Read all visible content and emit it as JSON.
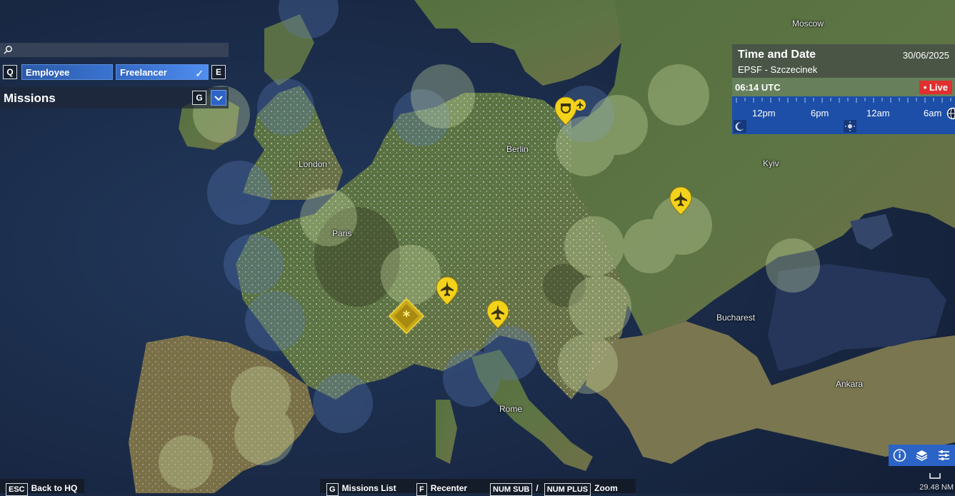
{
  "map": {
    "cities": [
      {
        "id": "moscow",
        "label": "Moscow"
      },
      {
        "id": "berlin",
        "label": "Berlin"
      },
      {
        "id": "london",
        "label": "London"
      },
      {
        "id": "paris",
        "label": "Paris"
      },
      {
        "id": "kyiv",
        "label": "Kyiv"
      },
      {
        "id": "bucharest",
        "label": "Bucharest"
      },
      {
        "id": "rome",
        "label": "Rome"
      },
      {
        "id": "ankara",
        "label": "Ankara"
      }
    ],
    "marker_icons": [
      "airplane-marker-icon",
      "pilot-marker-icon",
      "hq-diamond-icon"
    ]
  },
  "search": {
    "placeholder": "",
    "value": ""
  },
  "filters": {
    "left_key": "Q",
    "right_key": "E",
    "employee_label": "Employee",
    "freelancer_label": "Freelancer"
  },
  "missions": {
    "title": "Missions",
    "key": "G"
  },
  "time_panel": {
    "title": "Time and Date",
    "date": "30/06/2025",
    "location": "EPSF - Szczecinek",
    "utc_time": "06:14 UTC",
    "live_label": "• Live",
    "timeline_labels": [
      "12pm",
      "6pm",
      "12am",
      "6am"
    ]
  },
  "scale": {
    "label": "29.48 NM"
  },
  "hints": {
    "back": {
      "key": "ESC",
      "label": "Back to HQ"
    },
    "missions_list": {
      "key": "G",
      "label": "Missions List"
    },
    "recenter": {
      "key": "F",
      "label": "Recenter"
    },
    "zoom": {
      "key_sub": "NUM SUB",
      "separator": "/",
      "key_plus": "NUM PLUS",
      "label": "Zoom"
    }
  },
  "colors": {
    "sea": "#1b2a44",
    "land": "#4f6a3e",
    "marker_yellow": "#f3d21c",
    "accent_blue": "#2c63c6",
    "live_red": "#e02f2f"
  }
}
